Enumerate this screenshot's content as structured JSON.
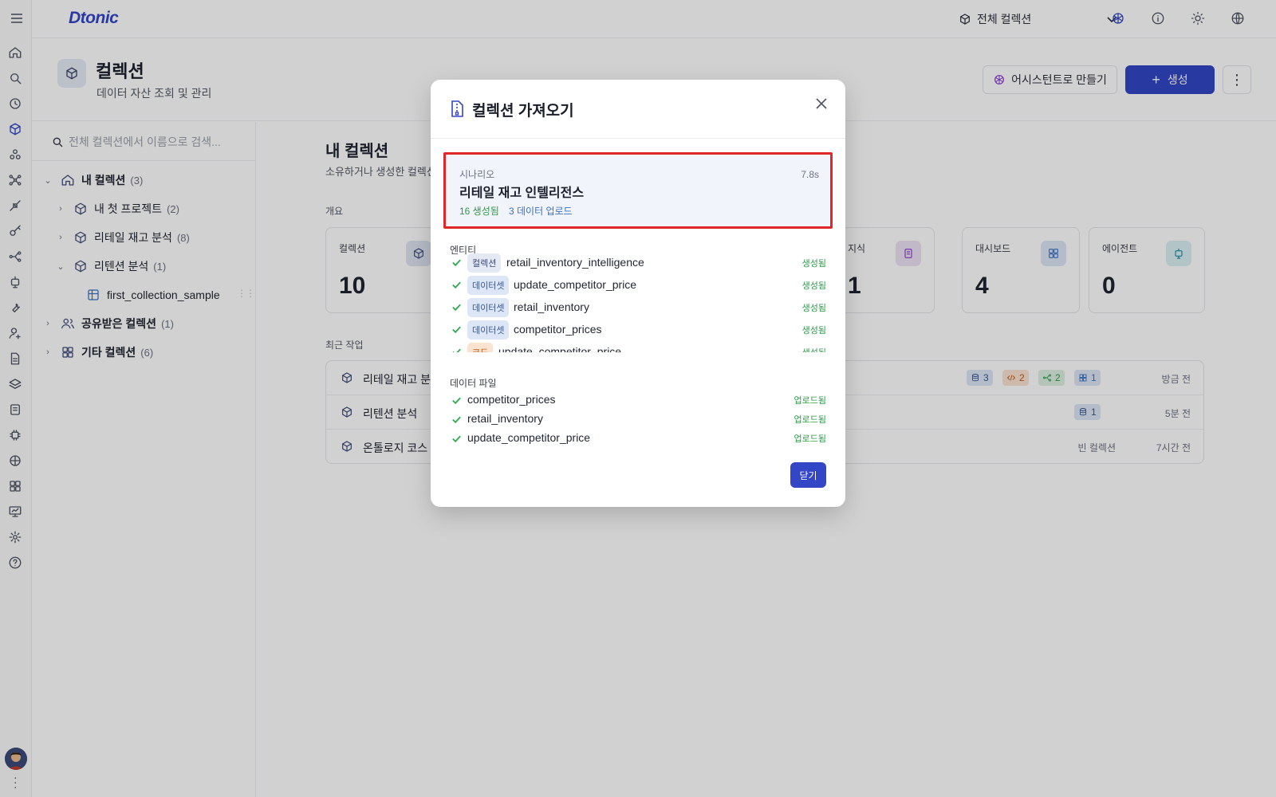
{
  "app": {
    "logo": "Dtonic"
  },
  "topbar": {
    "collection_selector": "전체 컬렉션"
  },
  "page": {
    "title": "컬렉션",
    "subtitle": "데이터 자산 조회 및 관리",
    "assistant_button": "어시스턴트로 만들기",
    "create_button": "생성"
  },
  "tree": {
    "search_placeholder": "전체 컬렉션에서 이름으로 검색...",
    "my_collections": {
      "label": "내 컬렉션",
      "count": "(3)"
    },
    "children": [
      {
        "label": "내 첫 프로젝트",
        "count": "(2)"
      },
      {
        "label": "리테일 재고 분석",
        "count": "(8)"
      },
      {
        "label": "리텐션 분석",
        "count": "(1)"
      }
    ],
    "sample": "first_collection_sample",
    "shared": {
      "label": "공유받은 컬렉션",
      "count": "(1)"
    },
    "other": {
      "label": "기타 컬렉션",
      "count": "(6)"
    }
  },
  "main": {
    "heading": "내 컬렉션",
    "subheading": "소유하거나 생성한 컬렉션",
    "overview_label": "개요",
    "stats": [
      {
        "label": "컬렉션",
        "value": "10"
      },
      {
        "label": "지식",
        "value": "1"
      },
      {
        "label": "대시보드",
        "value": "4"
      },
      {
        "label": "에이전트",
        "value": "0"
      }
    ],
    "recent_label": "최근 작업",
    "recent": [
      {
        "name": "리테일 재고 분석",
        "time": "방금 전",
        "chips": [
          "3",
          "2",
          "2",
          "1"
        ]
      },
      {
        "name": "리텐션 분석",
        "time": "5분 전",
        "chips": [
          "1"
        ]
      },
      {
        "name": "온톨로지 코스 화",
        "time": "7시간 전",
        "meta": "빈 컬렉션"
      }
    ]
  },
  "modal": {
    "title": "컬렉션 가져오기",
    "scenario": {
      "kicker": "시나리오",
      "name": "리테일 재고 인텔리전스",
      "time": "7.8s",
      "created": "16 생성됨",
      "uploaded": "3 데이터 업로드"
    },
    "entities_label": "엔티티",
    "entities": [
      {
        "tag": "컬렉션",
        "name": "retail_inventory_intelligence",
        "status": "생성됨"
      },
      {
        "tag": "데이터셋",
        "name": "update_competitor_price",
        "status": "생성됨"
      },
      {
        "tag": "데이터셋",
        "name": "retail_inventory",
        "status": "생성됨"
      },
      {
        "tag": "데이터셋",
        "name": "competitor_prices",
        "status": "생성됨"
      },
      {
        "tag": "코드",
        "name": "update_competitor_price",
        "status": "생성됨"
      }
    ],
    "files_label": "데이터 파일",
    "files": [
      {
        "name": "competitor_prices",
        "status": "업로드됨"
      },
      {
        "name": "retail_inventory",
        "status": "업로드됨"
      },
      {
        "name": "update_competitor_price",
        "status": "업로드됨"
      }
    ],
    "close_button": "닫기"
  },
  "colors": {
    "accent": "#3346c6",
    "success": "#2f9a4a",
    "highlight": "#e0262b"
  }
}
